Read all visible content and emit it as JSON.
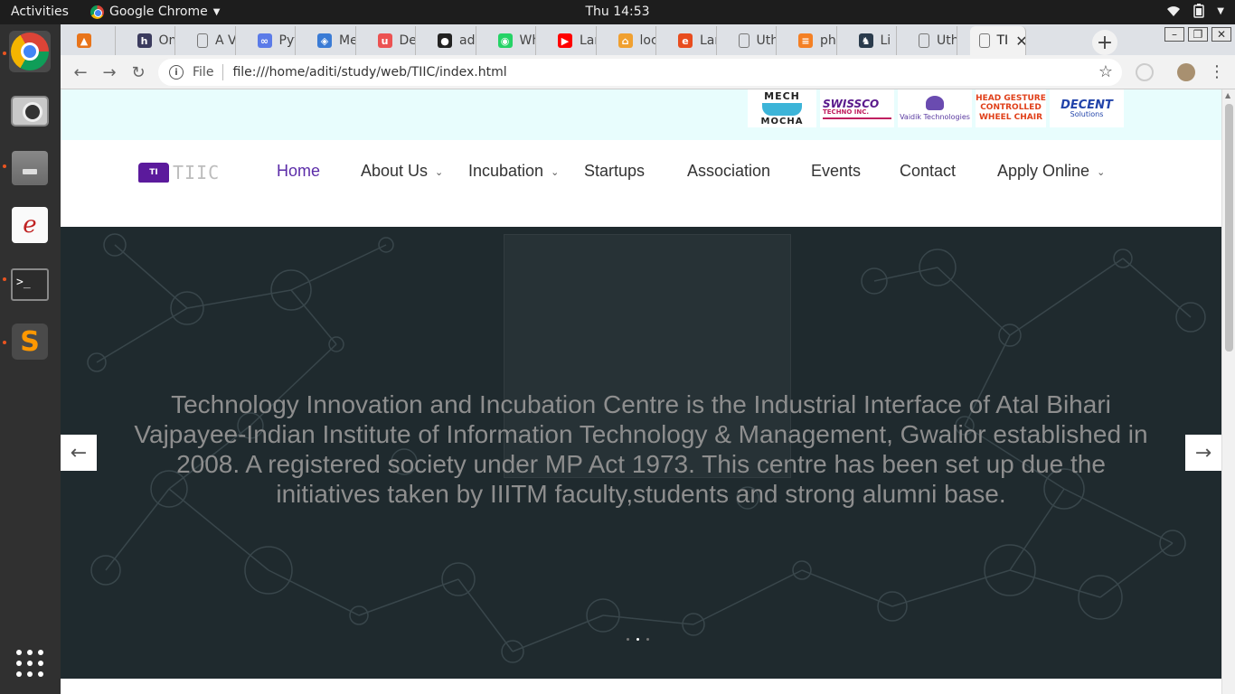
{
  "topbar": {
    "activities": "Activities",
    "app_name": "Google Chrome",
    "clock": "Thu 14:53"
  },
  "browser": {
    "tabs": [
      {
        "title": "",
        "icon": "matlab-icon",
        "color": "#e8741a"
      },
      {
        "title": "Onlin",
        "icon": "hackerrank-icon",
        "color": "#3b3b5e"
      },
      {
        "title": "A Vis",
        "icon": "document-icon",
        "color": "#777777"
      },
      {
        "title": "Pytho",
        "icon": "link-icon",
        "color": "#5b7be8"
      },
      {
        "title": "Meth",
        "icon": "shield-icon",
        "color": "#3a7bd5"
      },
      {
        "title": "Deep",
        "icon": "udemy-icon",
        "color": "#ec5252"
      },
      {
        "title": "aditi",
        "icon": "github-icon",
        "color": "#222222"
      },
      {
        "title": "Wha",
        "icon": "whatsapp-icon",
        "color": "#25d366"
      },
      {
        "title": "Lara",
        "icon": "youtube-icon",
        "color": "#ff0000"
      },
      {
        "title": "local",
        "icon": "phpmyadmin-icon",
        "color": "#f0a030"
      },
      {
        "title": "Lara",
        "icon": "tutorial-icon",
        "color": "#e84c1e"
      },
      {
        "title": "Utha",
        "icon": "document-icon",
        "color": "#777777"
      },
      {
        "title": "php",
        "icon": "stackoverflow-icon",
        "color": "#f48024"
      },
      {
        "title": "Li",
        "icon": "lichess-icon",
        "color": "#2a3b4c"
      },
      {
        "title": "Utha",
        "icon": "document-icon",
        "color": "#777777"
      },
      {
        "title": "TI",
        "icon": "document-icon",
        "color": "#777777"
      }
    ],
    "address": {
      "scheme": "File",
      "url": "file:///home/aditi/study/web/TIIC/index.html"
    }
  },
  "page": {
    "sponsors": [
      {
        "name": "MECH MOCHA",
        "line1": "MECH",
        "line2": "MOCHA"
      },
      {
        "name": "SWISSCO TECHNO INC.",
        "line1": "SWISSCO",
        "line2": "TECHNO INC."
      },
      {
        "name": "Vaidik Technologies",
        "line1": "",
        "line2": "Vaidik Technologies"
      },
      {
        "name": "HEAD GESTURE CONTROLLED WHEEL CHAIR",
        "line1": "HEAD GESTURE",
        "line2": "CONTROLLED WHEEL CHAIR"
      },
      {
        "name": "DECENT Solutions",
        "line1": "DECENT",
        "line2": "Solutions"
      }
    ],
    "nav": {
      "home": "Home",
      "about": "About Us",
      "incubation": "Incubation",
      "startups": "Startups",
      "association": "Association",
      "events": "Events",
      "contact": "Contact",
      "apply": "Apply Online",
      "accent": "#5b2ca8"
    },
    "hero": {
      "text": "Technology Innovation and Incubation Centre is the Industrial Interface of Atal Bihari Vajpayee-Indian Institute of Information Technology & Management, Gwalior established in 2008. A registered society under MP Act 1973. This centre has been set up due the initiatives taken by IIITM faculty,students and strong alumni base.",
      "slides": 3,
      "active_slide": 2,
      "prev_label": "←",
      "next_label": "→"
    }
  }
}
